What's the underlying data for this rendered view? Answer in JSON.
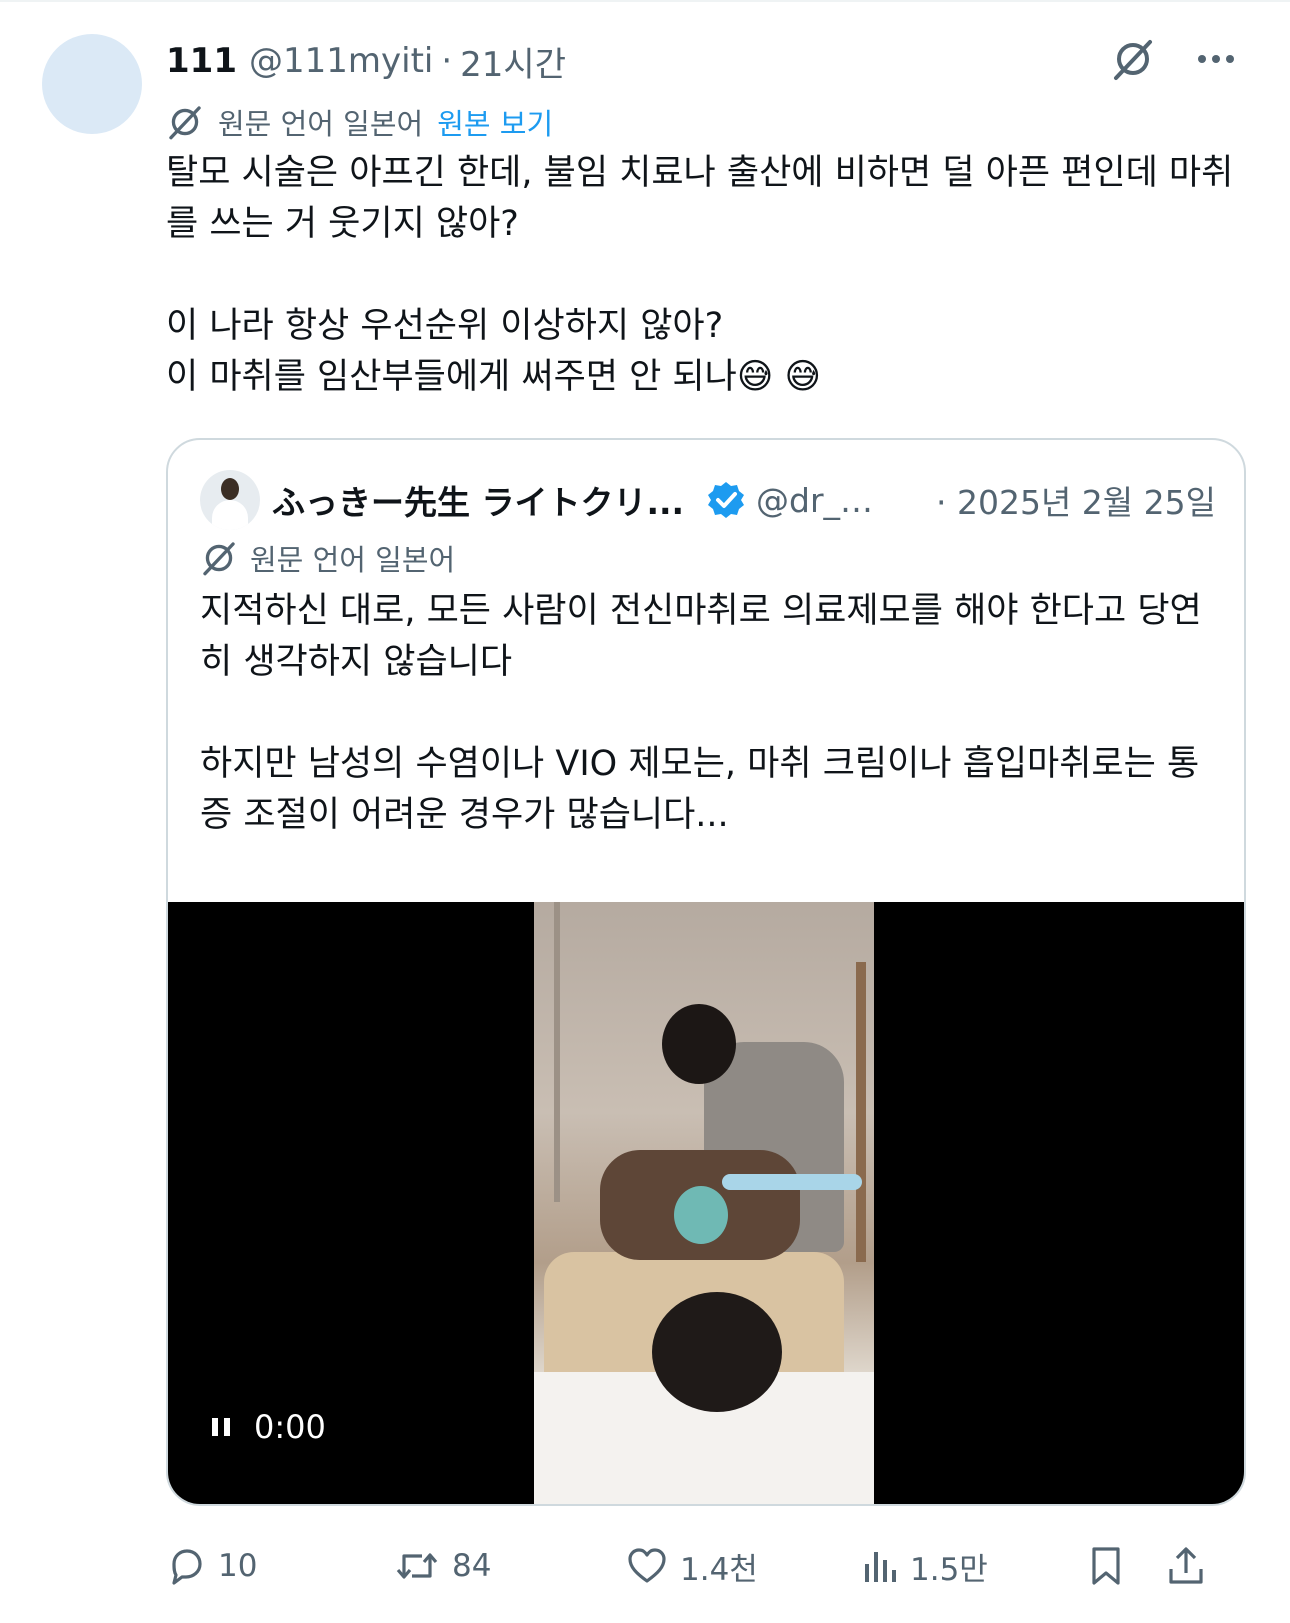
{
  "post": {
    "author_name": "111",
    "author_handle": "@111myiti",
    "separator": "·",
    "time": "21시간",
    "translation": {
      "label": "원문 언어 일본어",
      "view_original": "원본 보기"
    },
    "text": "탈모 시술은 아프긴 한데, 불임 치료나 출산에 비하면 덜 아픈 편인데 마취\n를 쓰는 거 웃기지 않아?\n\n이 나라 항상 우선순위 이상하지 않아?\n이 마취를 임산부들에게 써주면 안 되나😅 😅"
  },
  "quote": {
    "author_name": "ふっきー先生 ライトクリ...",
    "author_handle": "@dr_f...",
    "date": "· 2025년 2월 25일",
    "translation_label": "원문 언어 일본어",
    "text": "지적하신 대로, 모든 사람이 전신마취로 의료제모를 해야 한다고 당연\n히 생각하지 않습니다\n\n하지만 남성의 수염이나 VIO 제모는, 마취 크림이나 흡입마취로는 통\n증 조절이 어려운 경우가 많습니다...",
    "video": {
      "time": "0:00"
    }
  },
  "actions": {
    "replies": "10",
    "reposts": "84",
    "likes": "1.4천",
    "views": "1.5만"
  },
  "colors": {
    "accent": "#1d9bf0",
    "muted": "#536471",
    "text": "#0f1419",
    "border": "#cfd9de"
  }
}
